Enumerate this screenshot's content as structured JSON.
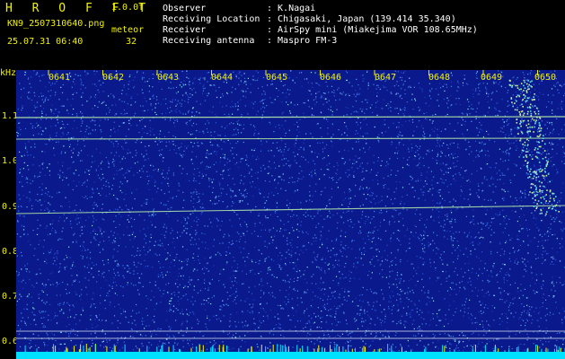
{
  "app": {
    "title": "H R O F F T",
    "version": "1.0.0f",
    "filename": "KN9_2507310640.png",
    "mode": "meteor",
    "datetime": "25.07.31 06:40",
    "count": "32"
  },
  "info": [
    {
      "label": "Observer",
      "value": ": K.Nagai"
    },
    {
      "label": "Receiving Location",
      "value": ": Chigasaki, Japan (139.414 35.340)"
    },
    {
      "label": "Receiver",
      "value": ": AirSpy mini (Miakejima VOR 108.65MHz)"
    },
    {
      "label": "Receiving antenna",
      "value": ": Maspro FM-3"
    }
  ],
  "spectrogram": {
    "unit": "kHz",
    "y_ticks": [
      "1.1",
      "1.0",
      "0.9",
      "0.8",
      "0.7",
      "0.6"
    ],
    "x_ticks": [
      "0641",
      "0642",
      "0643",
      "0644",
      "0645",
      "0646",
      "0647",
      "0648",
      "0649",
      "0650"
    ],
    "colors": {
      "background": "#0a1a8c",
      "trace": "#9fe8a0",
      "axis": "#f2f200",
      "floor": "#00e0ff"
    }
  }
}
